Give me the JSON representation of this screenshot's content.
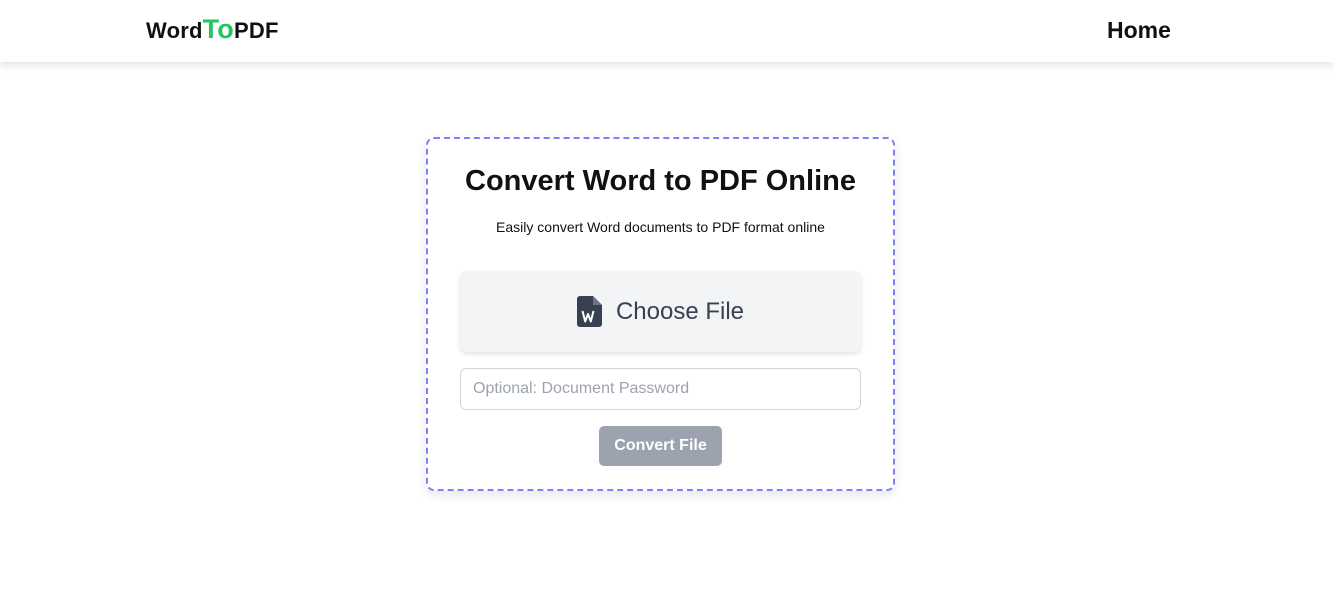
{
  "navbar": {
    "brand": {
      "part1": "Word",
      "part2": "To",
      "part3": "PDF"
    },
    "home_label": "Home"
  },
  "card": {
    "title": "Convert Word to PDF Online",
    "subtitle": "Easily convert Word documents to PDF format online",
    "choose_file_label": "Choose File",
    "choose_file_icon": "word-file-icon",
    "password_placeholder": "Optional: Document Password",
    "password_value": "",
    "convert_label": "Convert File"
  },
  "colors": {
    "brand_accent": "#22c55e",
    "card_border": "#7c83f0",
    "button_disabled": "#9ca3af",
    "file_icon": "#374151"
  }
}
